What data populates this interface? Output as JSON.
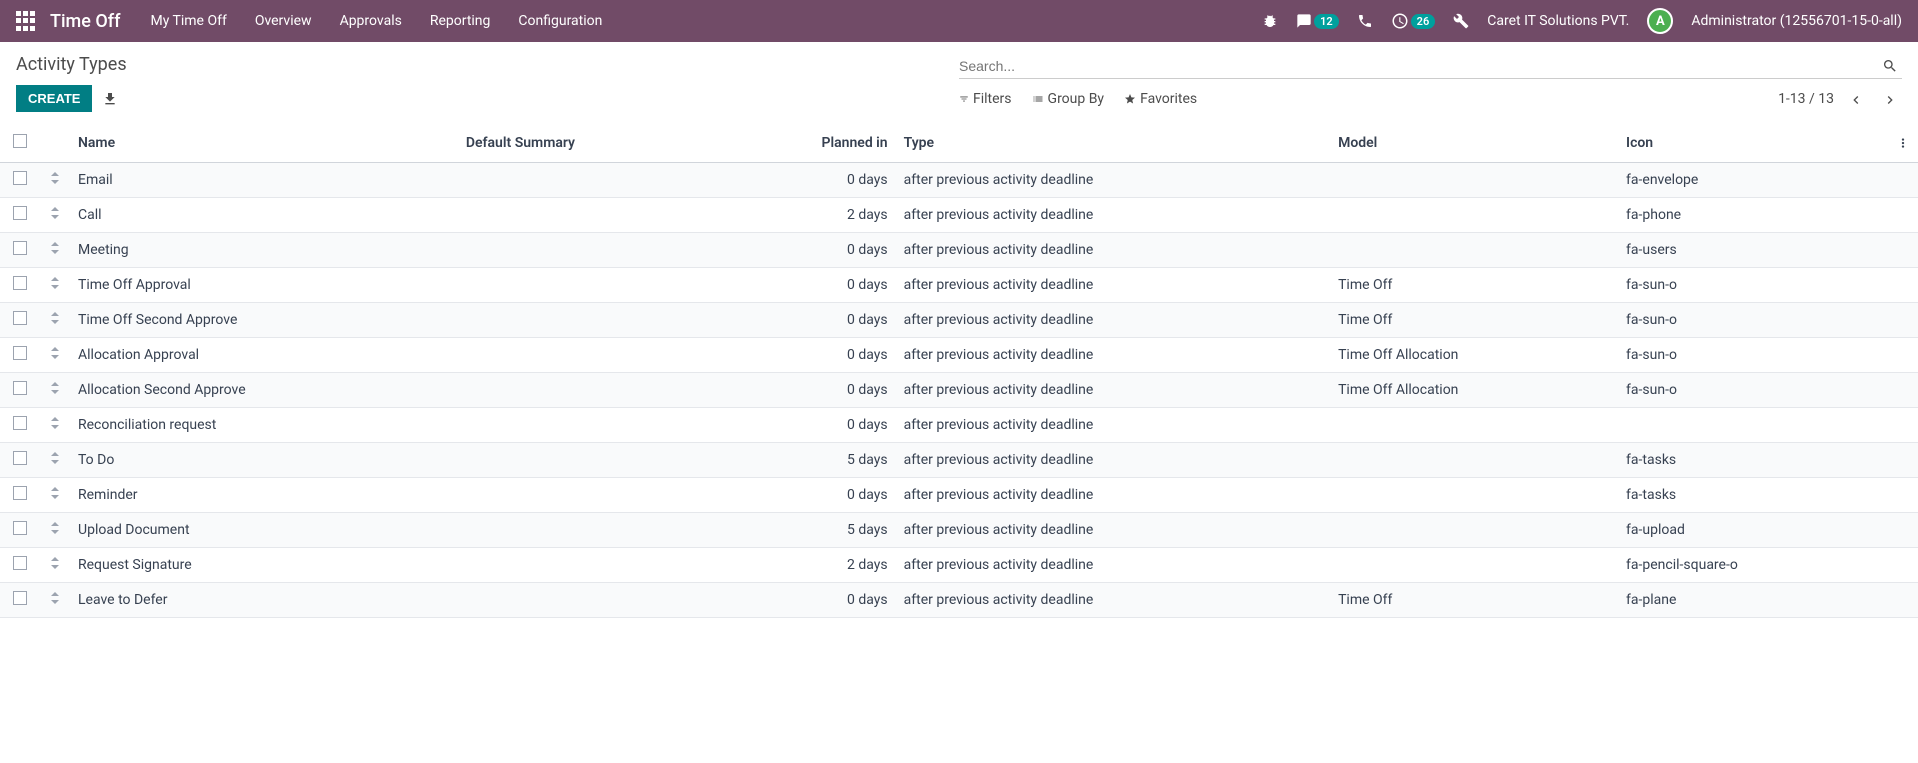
{
  "topnav": {
    "app_title": "Time Off",
    "menu": [
      "My Time Off",
      "Overview",
      "Approvals",
      "Reporting",
      "Configuration"
    ],
    "messages_badge": "12",
    "activities_badge": "26",
    "company": "Caret IT Solutions PVT.",
    "avatar_initial": "A",
    "user": "Administrator (12556701-15-0-all)"
  },
  "breadcrumb": {
    "title": "Activity Types"
  },
  "actions": {
    "create_label": "CREATE"
  },
  "search": {
    "placeholder": "Search..."
  },
  "filters": {
    "filters_label": "Filters",
    "groupby_label": "Group By",
    "favorites_label": "Favorites"
  },
  "pager": {
    "text": "1-13 / 13"
  },
  "table": {
    "headers": {
      "name": "Name",
      "default_summary": "Default Summary",
      "planned_in": "Planned in",
      "type": "Type",
      "model": "Model",
      "icon": "Icon"
    },
    "rows": [
      {
        "name": "Email",
        "default_summary": "",
        "planned_in": "0 days",
        "type": "after previous activity deadline",
        "model": "",
        "icon": "fa-envelope"
      },
      {
        "name": "Call",
        "default_summary": "",
        "planned_in": "2 days",
        "type": "after previous activity deadline",
        "model": "",
        "icon": "fa-phone"
      },
      {
        "name": "Meeting",
        "default_summary": "",
        "planned_in": "0 days",
        "type": "after previous activity deadline",
        "model": "",
        "icon": "fa-users"
      },
      {
        "name": "Time Off Approval",
        "default_summary": "",
        "planned_in": "0 days",
        "type": "after previous activity deadline",
        "model": "Time Off",
        "icon": "fa-sun-o"
      },
      {
        "name": "Time Off Second Approve",
        "default_summary": "",
        "planned_in": "0 days",
        "type": "after previous activity deadline",
        "model": "Time Off",
        "icon": "fa-sun-o"
      },
      {
        "name": "Allocation Approval",
        "default_summary": "",
        "planned_in": "0 days",
        "type": "after previous activity deadline",
        "model": "Time Off Allocation",
        "icon": "fa-sun-o"
      },
      {
        "name": "Allocation Second Approve",
        "default_summary": "",
        "planned_in": "0 days",
        "type": "after previous activity deadline",
        "model": "Time Off Allocation",
        "icon": "fa-sun-o"
      },
      {
        "name": "Reconciliation request",
        "default_summary": "",
        "planned_in": "0 days",
        "type": "after previous activity deadline",
        "model": "",
        "icon": ""
      },
      {
        "name": "To Do",
        "default_summary": "",
        "planned_in": "5 days",
        "type": "after previous activity deadline",
        "model": "",
        "icon": "fa-tasks"
      },
      {
        "name": "Reminder",
        "default_summary": "",
        "planned_in": "0 days",
        "type": "after previous activity deadline",
        "model": "",
        "icon": "fa-tasks"
      },
      {
        "name": "Upload Document",
        "default_summary": "",
        "planned_in": "5 days",
        "type": "after previous activity deadline",
        "model": "",
        "icon": "fa-upload"
      },
      {
        "name": "Request Signature",
        "default_summary": "",
        "planned_in": "2 days",
        "type": "after previous activity deadline",
        "model": "",
        "icon": "fa-pencil-square-o"
      },
      {
        "name": "Leave to Defer",
        "default_summary": "",
        "planned_in": "0 days",
        "type": "after previous activity deadline",
        "model": "Time Off",
        "icon": "fa-plane"
      }
    ]
  }
}
